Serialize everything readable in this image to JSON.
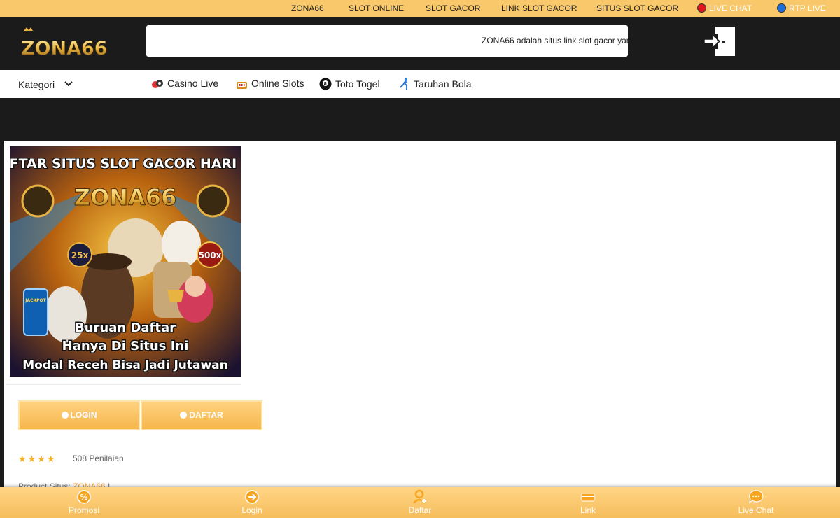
{
  "topbar": {
    "links": [
      "ZONA66",
      "SLOT ONLINE",
      "SLOT GACOR",
      "LINK SLOT GACOR",
      "SITUS SLOT GACOR"
    ],
    "live_chat": "LIVE CHAT",
    "rtp_live": "RTP LIVE",
    "live_chat_color": "#e0161b",
    "rtp_color": "#1c6fd6"
  },
  "header": {
    "logo_text": "ZONA66",
    "marquee_text": "ZONA66 adalah situs link slot gacor yan",
    "login_icon": "login-door-icon"
  },
  "category_bar": {
    "kategori_label": "Kategori",
    "items": [
      {
        "label": "Casino Live",
        "icon": "casino-chips-icon"
      },
      {
        "label": "Online Slots",
        "icon": "slot-machine-icon"
      },
      {
        "label": "Toto Togel",
        "icon": "eight-ball-icon"
      },
      {
        "label": "Taruhan Bola",
        "icon": "soccer-player-icon"
      }
    ]
  },
  "banner": {
    "headline": "DAFTAR SITUS SLOT GACOR HARI INI",
    "brand": "ZONA66",
    "multiplier_left": "25x",
    "multiplier_right": "500x",
    "jackpot": "JACKPOT",
    "lines": [
      "Buruan Daftar",
      "Hanya Di Situs Ini",
      "Modal Receh Bisa Jadi Jutawan"
    ]
  },
  "actions": {
    "login_label": "LOGIN",
    "daftar_label": "DAFTAR"
  },
  "rating": {
    "stars": "★★★★",
    "count_text": "508 Penilaian"
  },
  "product": {
    "label": "Product Situs:",
    "value": "ZONA66",
    "separator": "|"
  },
  "bottom_nav": [
    {
      "label": "Promosi",
      "icon": "promo-percent-icon"
    },
    {
      "label": "Login",
      "icon": "login-arrow-icon"
    },
    {
      "label": "Daftar",
      "icon": "add-user-icon"
    },
    {
      "label": "Link",
      "icon": "link-card-icon"
    },
    {
      "label": "Live Chat",
      "icon": "chat-bubble-icon"
    }
  ],
  "colors": {
    "accent": "#f9c86b",
    "dark": "#1b1b1b",
    "gold_text": "#f0a23c"
  }
}
